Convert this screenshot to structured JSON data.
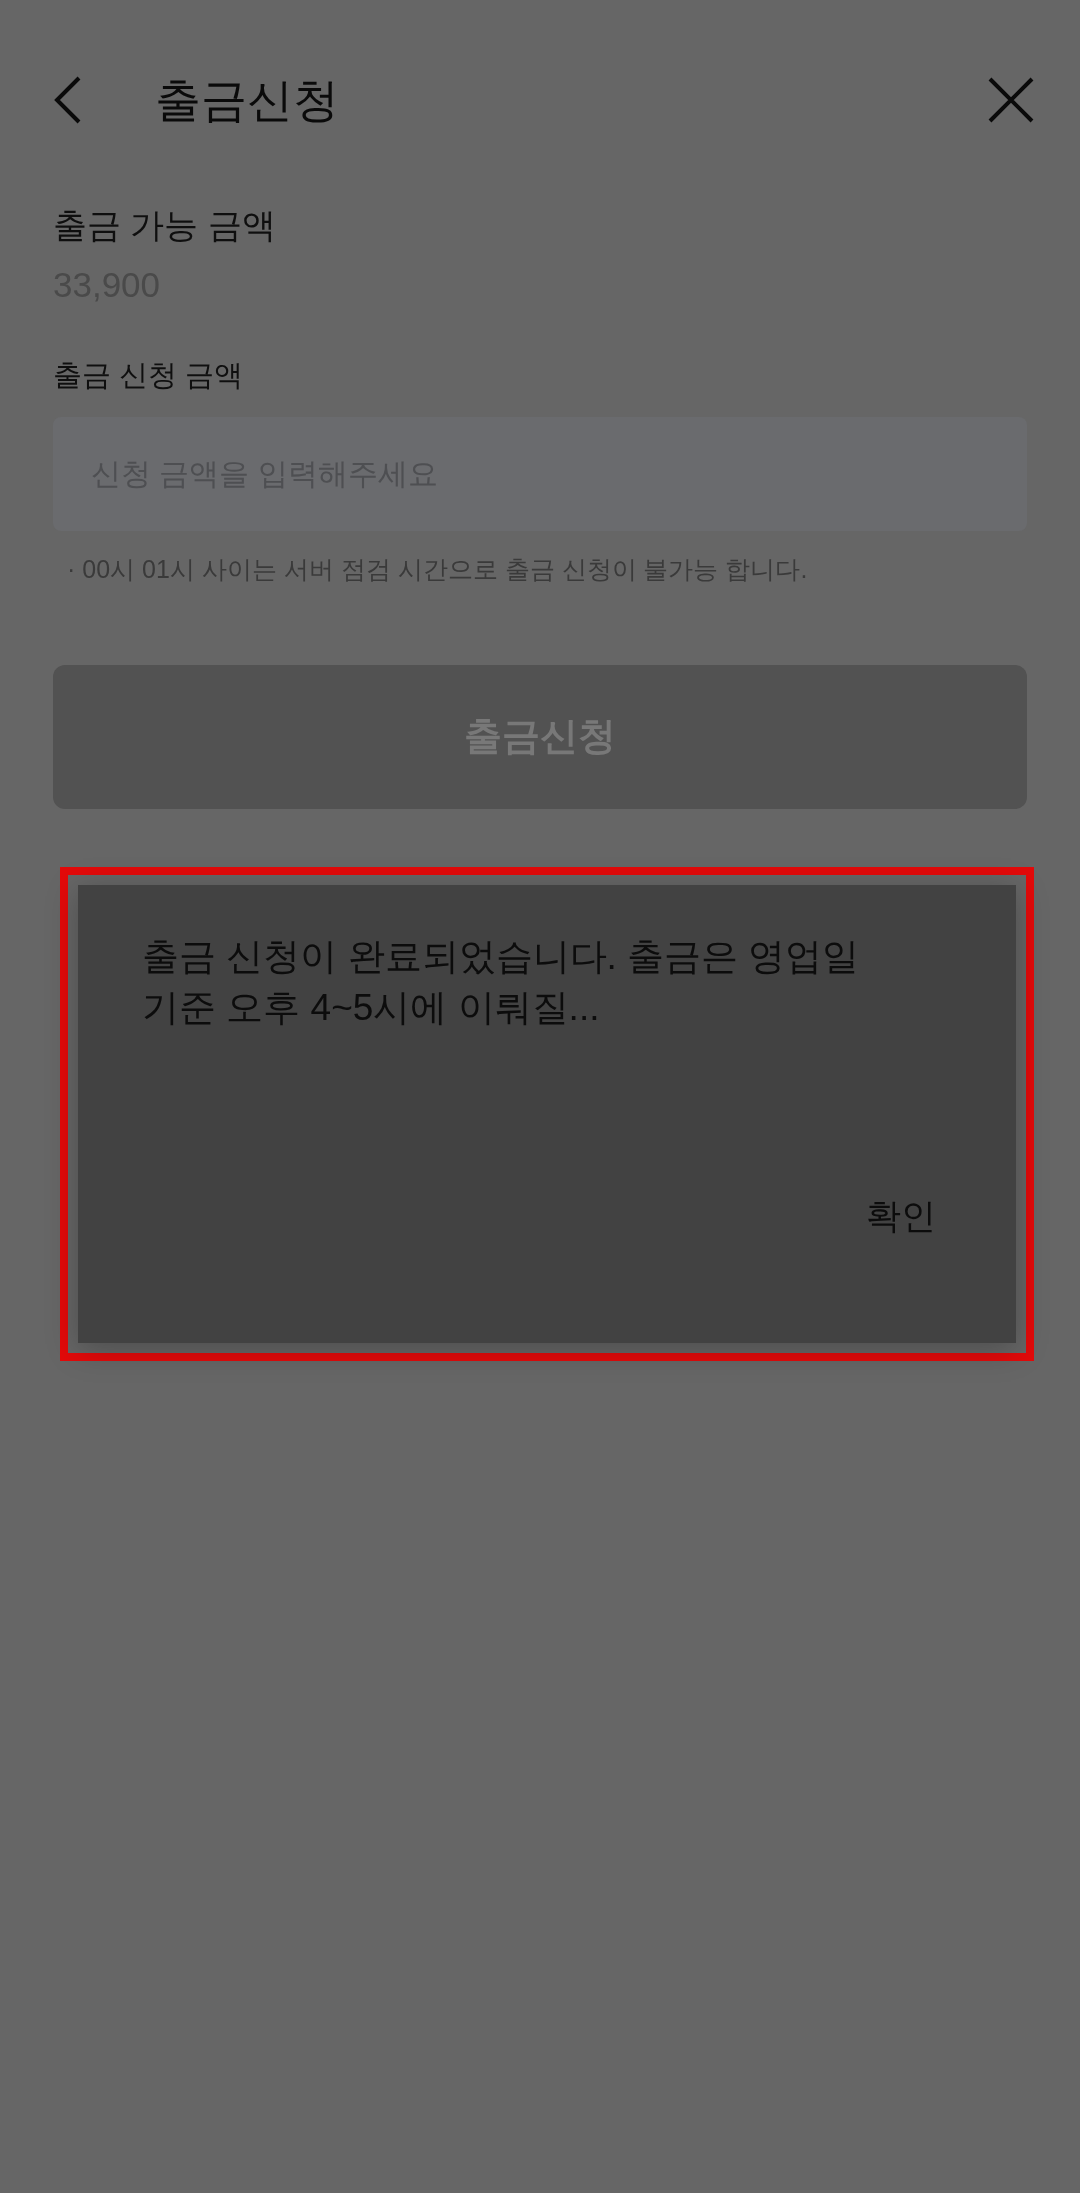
{
  "header": {
    "title": "출금신청"
  },
  "available": {
    "label": "출금 가능 금액",
    "amount": "33,900"
  },
  "request": {
    "label": "출금 신청 금액",
    "placeholder": "신청 금액을 입력해주세요",
    "note": "· 00시 01시 사이는 서버 점검 시간으로 출금 신청이 불가능 합니다."
  },
  "submit_button": {
    "label": "출금신청",
    "disabled": true
  },
  "dialog": {
    "message": "출금 신청이 완료되었습니다. 출금은 영업일 기준 오후 4~5시에 이뤄질...",
    "confirm": "확인",
    "highlighted": true
  }
}
